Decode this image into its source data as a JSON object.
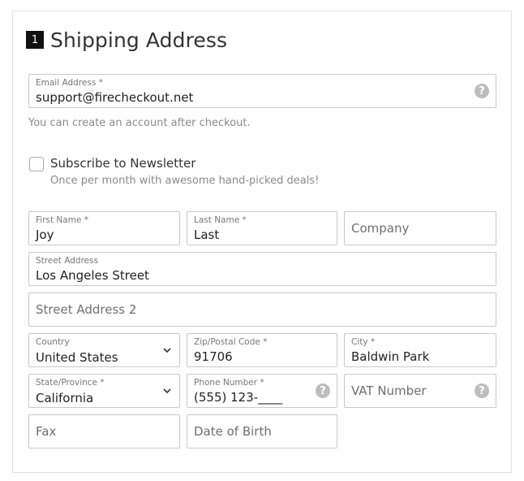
{
  "section": {
    "step": "1",
    "title": "Shipping Address"
  },
  "email": {
    "label": "Email Address *",
    "value": "support@firecheckout.net"
  },
  "account_hint": "You can create an account after checkout.",
  "newsletter": {
    "label": "Subscribe to Newsletter",
    "description": "Once per month with awesome hand-picked deals!",
    "checked": false
  },
  "first_name": {
    "label": "First Name *",
    "value": "Joy"
  },
  "last_name": {
    "label": "Last Name *",
    "value": "Last"
  },
  "company": {
    "placeholder": "Company"
  },
  "street1": {
    "label": "Street Address",
    "value": "Los Angeles Street"
  },
  "street2": {
    "placeholder": "Street Address 2"
  },
  "country": {
    "label": "Country",
    "value": "United States"
  },
  "zip": {
    "label": "Zip/Postal Code *",
    "value": "91706"
  },
  "city": {
    "label": "City *",
    "value": "Baldwin Park"
  },
  "state": {
    "label": "State/Province *",
    "value": "California"
  },
  "phone": {
    "label": "Phone Number *",
    "value": "(555) 123-____"
  },
  "vat": {
    "placeholder": "VAT Number"
  },
  "fax": {
    "placeholder": "Fax"
  },
  "dob": {
    "placeholder": "Date of Birth"
  },
  "icons": {
    "help": "?"
  }
}
